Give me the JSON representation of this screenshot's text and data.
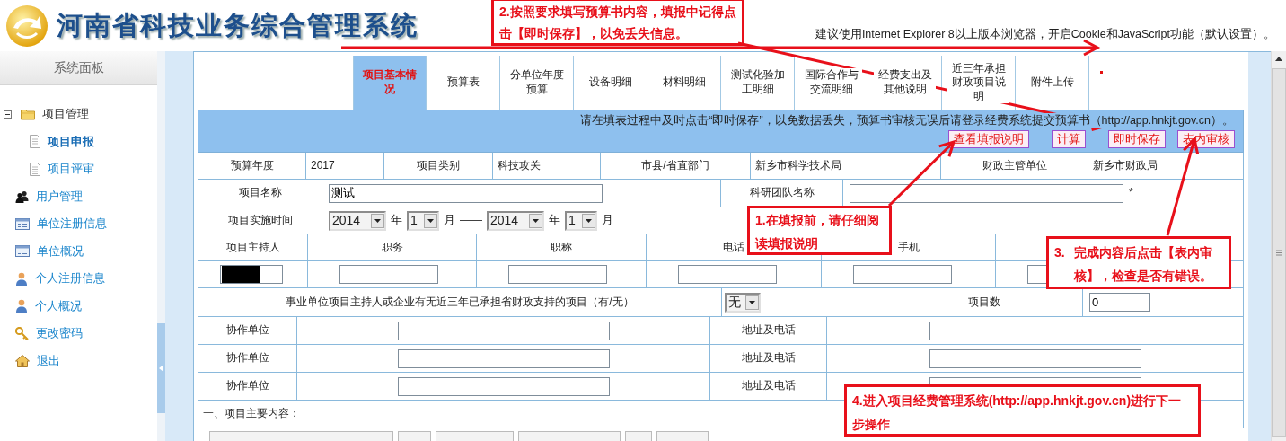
{
  "header": {
    "title": "河南省科技业务综合管理系统",
    "notice": "建议使用Internet Explorer 8以上版本浏览器，开启Cookie和JavaScript功能（默认设置）。"
  },
  "sidebar": {
    "title": "系统面板",
    "items": [
      {
        "label": "项目管理",
        "kind": "folder",
        "selected": false,
        "expanded": true,
        "children": [
          {
            "label": "项目申报",
            "kind": "doc",
            "selected": true
          },
          {
            "label": "项目评审",
            "kind": "doc",
            "selected": false
          }
        ]
      },
      {
        "label": "用户管理",
        "kind": "users",
        "selected": false
      },
      {
        "label": "单位注册信息",
        "kind": "card",
        "selected": false
      },
      {
        "label": "单位概况",
        "kind": "card",
        "selected": false
      },
      {
        "label": "个人注册信息",
        "kind": "person",
        "selected": false
      },
      {
        "label": "个人概况",
        "kind": "person",
        "selected": false
      },
      {
        "label": "更改密码",
        "kind": "key",
        "selected": false
      },
      {
        "label": "退出",
        "kind": "home",
        "selected": false
      }
    ]
  },
  "tabs": [
    {
      "label": "项目基本情况",
      "selected": true
    },
    {
      "label": "预算表",
      "selected": false
    },
    {
      "label": "分单位年度预算",
      "selected": false
    },
    {
      "label": "设备明细",
      "selected": false
    },
    {
      "label": "材料明细",
      "selected": false
    },
    {
      "label": "测试化验加工明细",
      "selected": false
    },
    {
      "label": "国际合作与交流明细",
      "selected": false
    },
    {
      "label": "经费支出及其他说明",
      "selected": false
    },
    {
      "label": "近三年承担财政项目说明",
      "selected": false
    },
    {
      "label": "附件上传",
      "selected": false
    }
  ],
  "info_bar": {
    "message": "请在填表过程中及时点击“即时保存”，以免数据丢失，预算书审核无误后请登录经费系统提交预算书（http://app.hnkjt.gov.cn）。",
    "buttons": [
      "查看填报说明",
      "计算",
      "即时保存",
      "表内审核"
    ]
  },
  "form": [
    {
      "kind": "summary",
      "cells": [
        {
          "kind": "label",
          "text": "预算年度"
        },
        {
          "kind": "value",
          "text": "2017"
        },
        {
          "kind": "label",
          "text": "项目类别"
        },
        {
          "kind": "value",
          "text": "科技攻关"
        },
        {
          "kind": "label",
          "text": "市县/省直部门"
        },
        {
          "kind": "value",
          "text": "新乡市科学技术局"
        },
        {
          "kind": "label",
          "text": "财政主管单位"
        },
        {
          "kind": "value",
          "text": "新乡市财政局"
        }
      ]
    },
    {
      "kind": "name",
      "cells": [
        {
          "kind": "label",
          "text": "项目名称"
        },
        {
          "kind": "input",
          "value": "测试"
        },
        {
          "kind": "label",
          "text": "科研团队名称"
        },
        {
          "kind": "input",
          "mark": "*"
        }
      ]
    },
    {
      "kind": "period",
      "cells": [
        {
          "kind": "label",
          "text": "项目实施时间"
        },
        {
          "kind": "period",
          "parts": [
            {
              "kind": "select",
              "value": "2014"
            },
            {
              "kind": "unit",
              "text": "年"
            },
            {
              "kind": "select",
              "value": "1"
            },
            {
              "kind": "unit",
              "text": "月"
            },
            {
              "kind": "unit",
              "text": "——"
            },
            {
              "kind": "select",
              "value": "2014"
            },
            {
              "kind": "unit",
              "text": "年"
            },
            {
              "kind": "select",
              "value": "1"
            },
            {
              "kind": "unit",
              "text": "月"
            }
          ]
        }
      ]
    },
    {
      "kind": "host",
      "cells": [
        {
          "kind": "label",
          "text": "项目主持人"
        },
        {
          "kind": "label",
          "text": "职务"
        },
        {
          "kind": "label",
          "text": "职称"
        },
        {
          "kind": "label",
          "text": "电话"
        },
        {
          "kind": "label",
          "text": "手机"
        }
      ]
    },
    {
      "kind": "host",
      "cells": [
        {
          "kind": "input",
          "redacted": true
        },
        {
          "kind": "input"
        },
        {
          "kind": "input"
        },
        {
          "kind": "input"
        },
        {
          "kind": "input"
        },
        {
          "kind": "input"
        }
      ]
    },
    {
      "kind": "support",
      "cells": [
        {
          "kind": "label",
          "text": "事业单位项目主持人或企业有无近三年已承担省财政支持的项目（有/无）"
        },
        {
          "kind": "select",
          "value": "无"
        },
        {
          "kind": "label",
          "text": "项目数"
        },
        {
          "kind": "input",
          "value": "0"
        }
      ]
    },
    {
      "kind": "partner",
      "cells": [
        {
          "kind": "label",
          "text": "协作单位"
        },
        {
          "kind": "input"
        },
        {
          "kind": "label",
          "text": "地址及电话"
        },
        {
          "kind": "input"
        }
      ]
    },
    {
      "kind": "partner",
      "cells": [
        {
          "kind": "label",
          "text": "协作单位"
        },
        {
          "kind": "input"
        },
        {
          "kind": "label",
          "text": "地址及电话"
        },
        {
          "kind": "input"
        }
      ]
    },
    {
      "kind": "partner",
      "cells": [
        {
          "kind": "label",
          "text": "协作单位"
        },
        {
          "kind": "input"
        },
        {
          "kind": "label",
          "text": "地址及电话"
        },
        {
          "kind": "input"
        }
      ]
    },
    {
      "kind": "section",
      "cells": [
        {
          "kind": "heading",
          "text": "一、项目主要内容："
        }
      ]
    }
  ],
  "annotations": [
    {
      "text": "2.按照要求填写预算书内容，填报中记得点击【即时保存】，以免丢失信息。"
    },
    {
      "text": "1.在填报前，请仔细阅读填报说明"
    },
    {
      "number": "3.",
      "text": "完成内容后点击【表内审核】，检查是否有错误。"
    },
    {
      "text": "4.进入项目经费管理系统(http://app.hnkjt.gov.cn)进行下一步操作"
    }
  ]
}
